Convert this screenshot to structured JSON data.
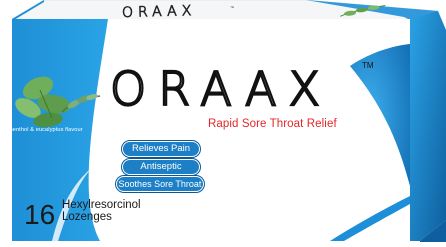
{
  "colors": {
    "brand_blue": "#1d8fd8",
    "deep_blue": "#0f5f9e",
    "tagline_red": "#e3262b",
    "leaf_green": "#6fae5b"
  },
  "top_flap": {
    "brand": "ORAAX",
    "trademark": "™"
  },
  "front": {
    "brand": "ORAAX",
    "trademark": "TM",
    "tagline": "Rapid Sore Throat Relief",
    "flavour": "menthol & eucalyptus flavour",
    "benefits": [
      "Relieves Pain",
      "Antiseptic",
      "Soothes Sore Throat"
    ],
    "quantity": "16",
    "ingredient": [
      "Hexylresorcinol",
      "Lozenges"
    ]
  },
  "icons": [
    "leaf-sprig-icon",
    "mint-leaves-icon",
    "eucalyptus-leaves-icon"
  ]
}
